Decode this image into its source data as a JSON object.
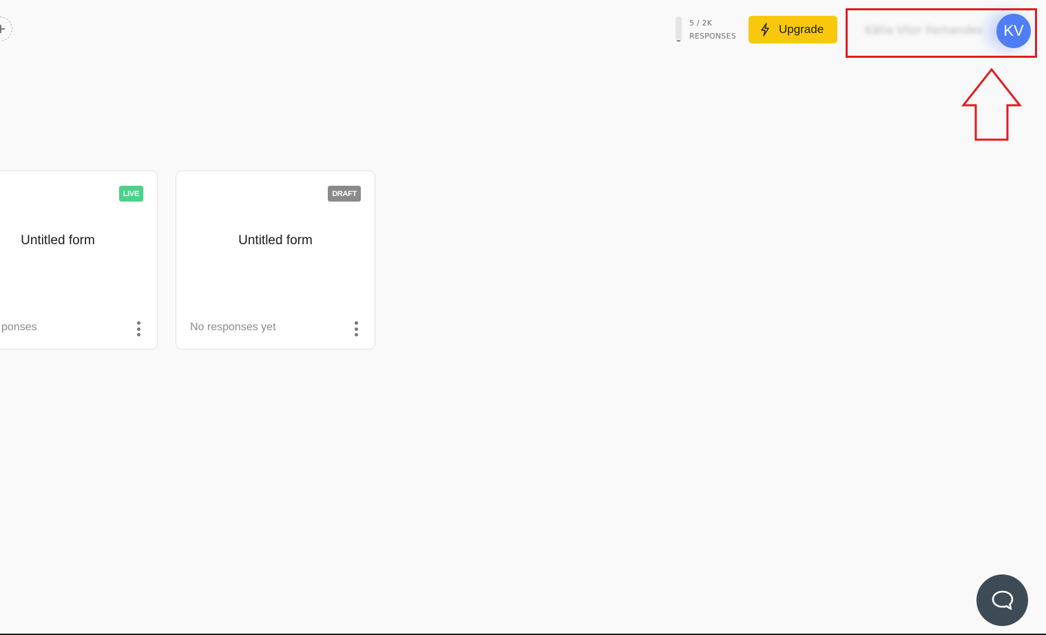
{
  "topbar": {
    "add_workspace_icon": "plus-icon",
    "usage": {
      "count": "5 / 2K",
      "label": "RESPONSES",
      "used": 5,
      "limit": 2000
    },
    "upgrade": {
      "label": "Upgrade",
      "icon": "lightning-bolt-icon",
      "color": "#f9c80e"
    },
    "account": {
      "name": "Kátia Vitor Fernandes",
      "initials": "KV",
      "avatar_color": "#4f7df5"
    }
  },
  "forms": [
    {
      "title": "Untitled form",
      "status": "LIVE",
      "status_color": "#4cd189",
      "responses_text": "ponses"
    },
    {
      "title": "Untitled form",
      "status": "DRAFT",
      "status_color": "#8a8a8a",
      "responses_text": "No responses yet"
    }
  ],
  "chat": {
    "icon": "chat-bubble-icon",
    "color": "#3d4b57"
  },
  "annotation": {
    "color": "#e11b22"
  }
}
